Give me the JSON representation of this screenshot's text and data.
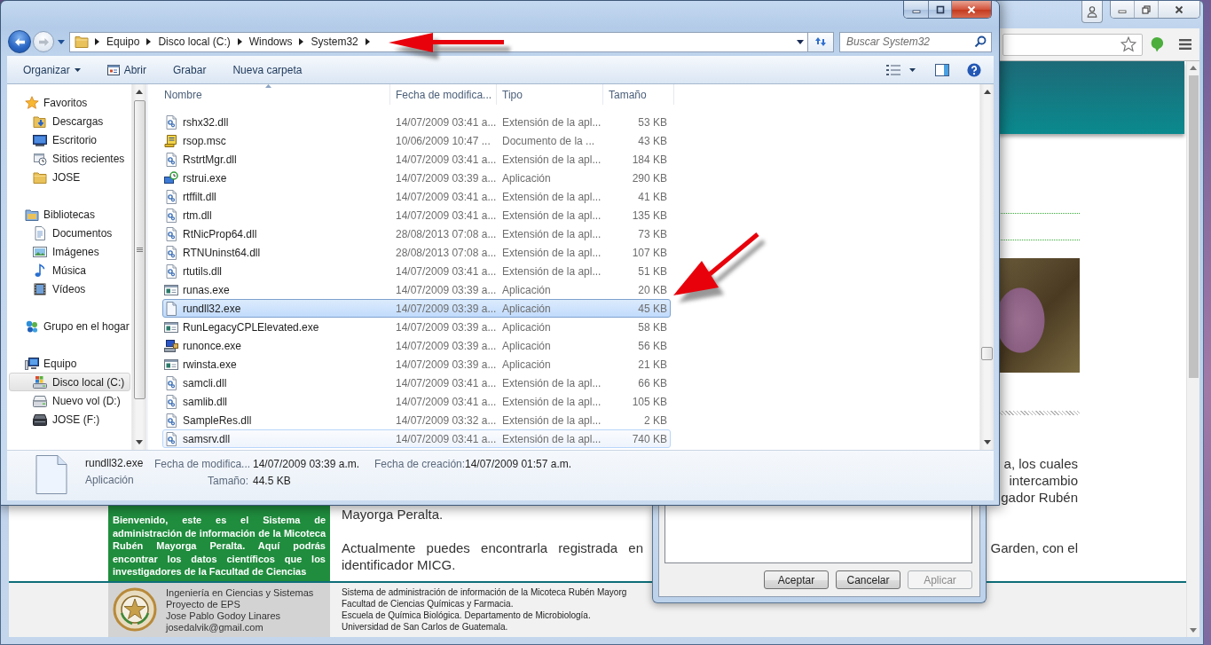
{
  "explorer": {
    "navigation": {
      "back": {
        "disabled": false
      },
      "forward": {
        "disabled": true
      }
    },
    "address": {
      "crumbs": [
        "Equipo",
        "Disco local (C:)",
        "Windows",
        "System32"
      ]
    },
    "search": {
      "placeholder": "Buscar System32"
    },
    "toolbar": [
      {
        "label": "Organizar",
        "kind": "menu"
      },
      {
        "label": "Abrir",
        "kind": "program"
      },
      {
        "label": "Grabar",
        "kind": "plain"
      },
      {
        "label": "Nueva carpeta",
        "kind": "plain"
      }
    ],
    "nav_tree": [
      {
        "label": "Favoritos",
        "kind": "star",
        "selected": false,
        "children": [
          {
            "label": "Descargas",
            "kind": "download",
            "selected": false
          },
          {
            "label": "Escritorio",
            "kind": "desktop",
            "selected": false
          },
          {
            "label": "Sitios recientes",
            "kind": "recent",
            "selected": false
          },
          {
            "label": "JOSE",
            "kind": "folder",
            "selected": false
          }
        ]
      },
      {
        "label": "Bibliotecas",
        "kind": "library",
        "selected": false,
        "children": [
          {
            "label": "Documentos",
            "kind": "document",
            "selected": false
          },
          {
            "label": "Imágenes",
            "kind": "picture",
            "selected": false
          },
          {
            "label": "Música",
            "kind": "music",
            "selected": false
          },
          {
            "label": "Vídeos",
            "kind": "video",
            "selected": false
          }
        ]
      },
      {
        "label": "Grupo en el hogar",
        "kind": "homegroup",
        "selected": false
      },
      {
        "label": "Equipo",
        "kind": "computer",
        "selected": false,
        "children": [
          {
            "label": "Disco local (C:)",
            "kind": "system-drive",
            "selected": true
          },
          {
            "label": "Nuevo vol (D:)",
            "kind": "drive",
            "selected": false
          },
          {
            "label": "JOSE (F:)",
            "kind": "removable",
            "selected": false
          }
        ]
      }
    ],
    "columns": [
      {
        "label": "Nombre",
        "sorted": true
      },
      {
        "label": "Fecha de modifica...",
        "sorted": false
      },
      {
        "label": "Tipo",
        "sorted": false
      },
      {
        "label": "Tamaño",
        "sorted": false
      }
    ],
    "files": [
      {
        "name": "rshx32.dll",
        "modified": "14/07/2009 03:41 a...",
        "type": "Extensión de la apl...",
        "size": "53 KB",
        "kind": "dll",
        "selected": false,
        "hovered": false
      },
      {
        "name": "rsop.msc",
        "modified": "10/06/2009 10:47 ...",
        "type": "Documento de la ...",
        "size": "43 KB",
        "kind": "script",
        "selected": false,
        "hovered": false
      },
      {
        "name": "RstrtMgr.dll",
        "modified": "14/07/2009 03:41 a...",
        "type": "Extensión de la apl...",
        "size": "184 KB",
        "kind": "dll",
        "selected": false,
        "hovered": false
      },
      {
        "name": "rstrui.exe",
        "modified": "14/07/2009 03:39 a...",
        "type": "Aplicación",
        "size": "290 KB",
        "kind": "restore",
        "selected": false,
        "hovered": false
      },
      {
        "name": "rtffilt.dll",
        "modified": "14/07/2009 03:41 a...",
        "type": "Extensión de la apl...",
        "size": "41 KB",
        "kind": "dll",
        "selected": false,
        "hovered": false
      },
      {
        "name": "rtm.dll",
        "modified": "14/07/2009 03:41 a...",
        "type": "Extensión de la apl...",
        "size": "135 KB",
        "kind": "dll",
        "selected": false,
        "hovered": false
      },
      {
        "name": "RtNicProp64.dll",
        "modified": "28/08/2013 07:08 a...",
        "type": "Extensión de la apl...",
        "size": "73 KB",
        "kind": "dll",
        "selected": false,
        "hovered": false
      },
      {
        "name": "RTNUninst64.dll",
        "modified": "28/08/2013 07:08 a...",
        "type": "Extensión de la apl...",
        "size": "107 KB",
        "kind": "dll",
        "selected": false,
        "hovered": false
      },
      {
        "name": "rtutils.dll",
        "modified": "14/07/2009 03:41 a...",
        "type": "Extensión de la apl...",
        "size": "51 KB",
        "kind": "dll",
        "selected": false,
        "hovered": false
      },
      {
        "name": "runas.exe",
        "modified": "14/07/2009 03:39 a...",
        "type": "Aplicación",
        "size": "20 KB",
        "kind": "app",
        "selected": false,
        "hovered": false
      },
      {
        "name": "rundll32.exe",
        "modified": "14/07/2009 03:39 a...",
        "type": "Aplicación",
        "size": "45 KB",
        "kind": "blank",
        "selected": true,
        "hovered": false
      },
      {
        "name": "RunLegacyCPLElevated.exe",
        "modified": "14/07/2009 03:39 a...",
        "type": "Aplicación",
        "size": "58 KB",
        "kind": "app",
        "selected": false,
        "hovered": false
      },
      {
        "name": "runonce.exe",
        "modified": "14/07/2009 03:39 a...",
        "type": "Aplicación",
        "size": "56 KB",
        "kind": "setup",
        "selected": false,
        "hovered": false
      },
      {
        "name": "rwinsta.exe",
        "modified": "14/07/2009 03:39 a...",
        "type": "Aplicación",
        "size": "21 KB",
        "kind": "app",
        "selected": false,
        "hovered": false
      },
      {
        "name": "samcli.dll",
        "modified": "14/07/2009 03:41 a...",
        "type": "Extensión de la apl...",
        "size": "66 KB",
        "kind": "dll",
        "selected": false,
        "hovered": false
      },
      {
        "name": "samlib.dll",
        "modified": "14/07/2009 03:41 a...",
        "type": "Extensión de la apl...",
        "size": "105 KB",
        "kind": "dll",
        "selected": false,
        "hovered": false
      },
      {
        "name": "SampleRes.dll",
        "modified": "14/07/2009 03:32 a...",
        "type": "Extensión de la apl...",
        "size": "2 KB",
        "kind": "dll",
        "selected": false,
        "hovered": false
      },
      {
        "name": "samsrv.dll",
        "modified": "14/07/2009 03:41 a...",
        "type": "Extensión de la apl...",
        "size": "740 KB",
        "kind": "dll",
        "selected": false,
        "hovered": true
      }
    ],
    "details": {
      "name": "rundll32.exe",
      "type": "Aplicación",
      "fields": [
        {
          "label": "Fecha de modifica...",
          "value": "14/07/2009 03:39 a.m."
        },
        {
          "label": "Fecha de creación:",
          "value": "14/07/2009 01:57 a.m."
        },
        {
          "label": "Tamaño:",
          "value": "44.5 KB"
        }
      ]
    }
  },
  "dialog": {
    "buttons": [
      {
        "label": "Aceptar",
        "disabled": false
      },
      {
        "label": "Cancelar",
        "disabled": false
      },
      {
        "label": "Aplicar",
        "disabled": true
      }
    ]
  },
  "browser": {
    "page": {
      "fragment_lines": [
        "a, los cuales",
        "intercambio",
        "gador Rubén"
      ],
      "welcome": "Bienvenido, este es el Sistema de administración de información de la Micoteca Rubén Mayorga Peralta. Aquí podrás encontrar los datos científicos que los investigadores de la Facultad de Ciencias",
      "paragraphs": [
        "Mayorga Peralta.",
        "Actualmente puedes encontrarla registrada en identificador MICG."
      ],
      "line_end": "Garden, con el",
      "footer": {
        "credits": [
          "Ingeniería en Ciencias y Sistemas",
          "Proyecto de EPS",
          "Jose Pablo Godoy Linares",
          "josedalvik@gmail.com"
        ],
        "info": [
          "Sistema de administración de información de la Micoteca Rubén Mayorg",
          "Facultad de Ciencias Químicas y Farmacia.",
          "Escuela de Química Biológica. Departamento de Microbiología.",
          "Universidad de San Carlos de Guatemala."
        ]
      }
    }
  }
}
